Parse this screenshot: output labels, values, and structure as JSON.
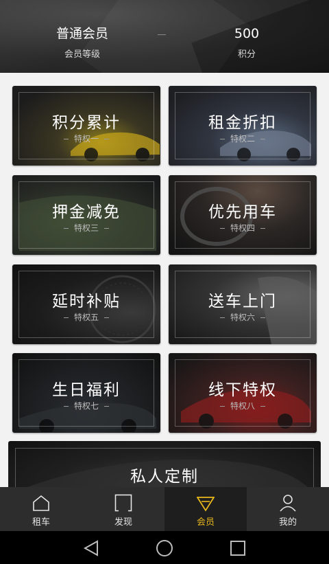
{
  "header": {
    "level_value": "普通会员",
    "level_label": "会员等级",
    "points_value": "500",
    "points_label": "积分"
  },
  "privileges": [
    {
      "title": "积分累计",
      "sub": "特权一"
    },
    {
      "title": "租金折扣",
      "sub": "特权二"
    },
    {
      "title": "押金减免",
      "sub": "特权三"
    },
    {
      "title": "优先用车",
      "sub": "特权四"
    },
    {
      "title": "延时补贴",
      "sub": "特权五"
    },
    {
      "title": "送车上门",
      "sub": "特权六"
    },
    {
      "title": "生日福利",
      "sub": "特权七"
    },
    {
      "title": "线下特权",
      "sub": "特权八"
    }
  ],
  "custom": {
    "title": "私人定制"
  },
  "tabs": [
    {
      "label": "租车",
      "icon": "home-icon"
    },
    {
      "label": "发现",
      "icon": "discover-icon"
    },
    {
      "label": "会员",
      "icon": "member-diamond-icon",
      "active": true
    },
    {
      "label": "我的",
      "icon": "profile-icon"
    }
  ],
  "colors": {
    "accent": "#e9b81c",
    "tabbar": "#2d2d2d",
    "tab_active": "#1e1e1e"
  },
  "system_nav": [
    "back-icon",
    "home-circle-icon",
    "recents-icon"
  ]
}
